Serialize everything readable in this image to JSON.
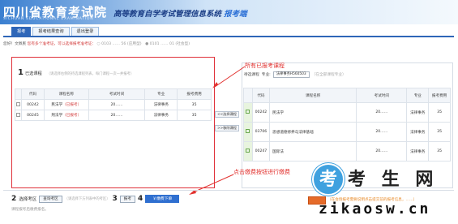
{
  "header": {
    "logo_cn": "四川省教育考试院",
    "logo_en": "SICHUAN EDUCATIONAL EXAMINATION",
    "system_title": "高等教育自学考试管理信息系统",
    "system_highlight": "报考端"
  },
  "tabs": [
    "报考",
    "报考结果查询",
    "退出登录"
  ],
  "notice": {
    "prefix": "您好！文佩民",
    "warning": "您有多个准考证，可以选择报考准考证：",
    "option1": "0103 …… 56 (应用型)",
    "option2": "0101 …… 01 (社会型)"
  },
  "step1": {
    "num": "1",
    "label": "已选课程",
    "hint": "（请选择右侧的待选课程列表，每门课程一次一并报考）"
  },
  "left_table": {
    "headers": [
      "",
      "代码",
      "课程名称",
      "考试时间",
      "专业",
      "报考费用"
    ],
    "rows": [
      {
        "code": "00242",
        "name": "民法学",
        "tag": "（已报考）",
        "time": "20……",
        "major": "法律事务",
        "fee": "35"
      },
      {
        "code": "00245",
        "name": "刑法学",
        "tag": "（已报考）",
        "time": "20……",
        "major": "法律事务",
        "fee": "35"
      }
    ]
  },
  "mid_buttons": [
    "<<选择课程",
    ">>移除课程"
  ],
  "annotations": {
    "top": "所有已报考课程",
    "bottom": "点击缴费按钮进行缴费"
  },
  "right_panel": {
    "label": "待选课程",
    "filter_label": "专业:",
    "select_value": "法律事务H560503",
    "hint": "（在全部课程专业）"
  },
  "right_table": {
    "headers": [
      "",
      "代码",
      "课程名称",
      "考试时间",
      "专业",
      "报考费用"
    ],
    "rows": [
      {
        "code": "00242",
        "name": "民法学",
        "time": "20……",
        "major": "法律事务",
        "fee": "35"
      },
      {
        "code": "03706",
        "name": "思想道德修养与法律基础",
        "time": "20……",
        "major": "法律事务",
        "fee": "35"
      },
      {
        "code": "00247",
        "name": "国际法",
        "time": "20……",
        "major": "法律事务",
        "fee": "35"
      }
    ]
  },
  "bottom": {
    "step2_num": "2",
    "step2_label": "选择考区",
    "step2_button": "查询考区",
    "step2_hint": "（请选择下方列表中的考区）",
    "step3_num": "3",
    "step3_button": "报考",
    "step4_num": "4",
    "step4_button": "￥缴费下单",
    "line2": "课程报考后缴费报名。",
    "right_notice": "（在会场报考需要说明点击提交前的报考信息，……）"
  },
  "watermark": {
    "circle": "考",
    "text": "考 生 网",
    "url": "zikaosw.cn"
  },
  "colors": {
    "brand_blue": "#2e66b8",
    "annotation_red": "#e2322f",
    "pay_orange": "#e56b2a"
  }
}
